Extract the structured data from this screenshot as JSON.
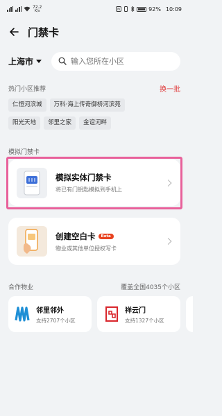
{
  "status_bar": {
    "left_text": "72.2",
    "speed_unit": "K/s",
    "battery": "92%",
    "time": "10:09"
  },
  "header": {
    "title": "门禁卡"
  },
  "city_selector": {
    "city": "上海市"
  },
  "search": {
    "placeholder": "输入您所在小区"
  },
  "hot": {
    "title": "热门小区推荐",
    "refresh_label": "换一批",
    "chips_row1": [
      "仁恒河滨城",
      "万科·海上传奇御桥河滨苑"
    ],
    "chips_row2": [
      "阳光天地",
      "邻里之家",
      "金谊河畔"
    ]
  },
  "simulate": {
    "section_title": "模拟门禁卡",
    "card_title": "模拟实体门禁卡",
    "card_sub": "将已有门钥匙模拟到手机上"
  },
  "blank": {
    "card_title": "创建空白卡",
    "badge": "Beta",
    "card_sub": "物业或其他单位授权写卡"
  },
  "partners": {
    "title": "合作物业",
    "coverage": "覆盖全国4035个小区",
    "items": [
      {
        "name": "邻里邻外",
        "sub": "支持2707个小区"
      },
      {
        "name": "祥云门",
        "sub": "支持1327个小区"
      }
    ]
  },
  "colors": {
    "accent_red": "#e03a3a",
    "highlight_pink": "#e8609a",
    "beta_badge": "#e8421f",
    "partner1_logo": "#1e8fd6",
    "partner2_logo": "#d9262c"
  }
}
